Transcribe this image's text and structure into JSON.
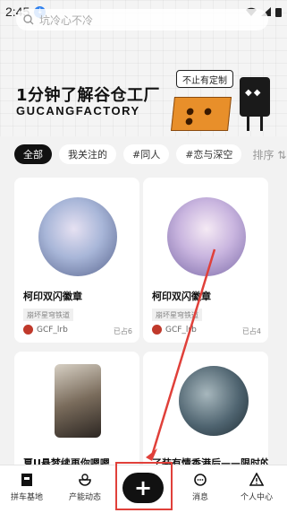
{
  "status": {
    "time": "2:45"
  },
  "search": {
    "placeholder": "坑冷心不冷"
  },
  "banner": {
    "title": "1分钟了解谷仓工厂",
    "subtitle": "GUCANGFACTORY",
    "bubble": "不止有定制"
  },
  "tabs": [
    {
      "label": "全部",
      "active": true
    },
    {
      "label": "我关注的",
      "active": false
    },
    {
      "label": "#同人",
      "active": false
    },
    {
      "label": "#恋与深空",
      "active": false
    }
  ],
  "sort_label": "排序",
  "cards": [
    {
      "name": "柯印双闪徽章",
      "tag": "崩坏星穹铁道",
      "user": "GCF_lrb",
      "stock": "已占6"
    },
    {
      "name": "柯印双闪徽章",
      "tag": "崩坏星穹铁道",
      "user": "GCF_lrb",
      "stock": "已占4"
    },
    {
      "name": "夏U悬梦续再你嗯嗯",
      "tag": "",
      "user": "",
      "stock": ""
    },
    {
      "name": "了装有情香港后——限时的",
      "tag": "",
      "user": "",
      "stock": ""
    }
  ],
  "nav": {
    "items": [
      {
        "label": "拼车基地",
        "icon": "flag-icon"
      },
      {
        "label": "产能动态",
        "icon": "bowl-icon"
      },
      {
        "label": "",
        "icon": "plus-icon"
      },
      {
        "label": "消息",
        "icon": "chat-icon"
      },
      {
        "label": "个人中心",
        "icon": "warning-icon"
      }
    ]
  },
  "colors": {
    "accent": "#111111",
    "annotation": "#e0403a"
  }
}
